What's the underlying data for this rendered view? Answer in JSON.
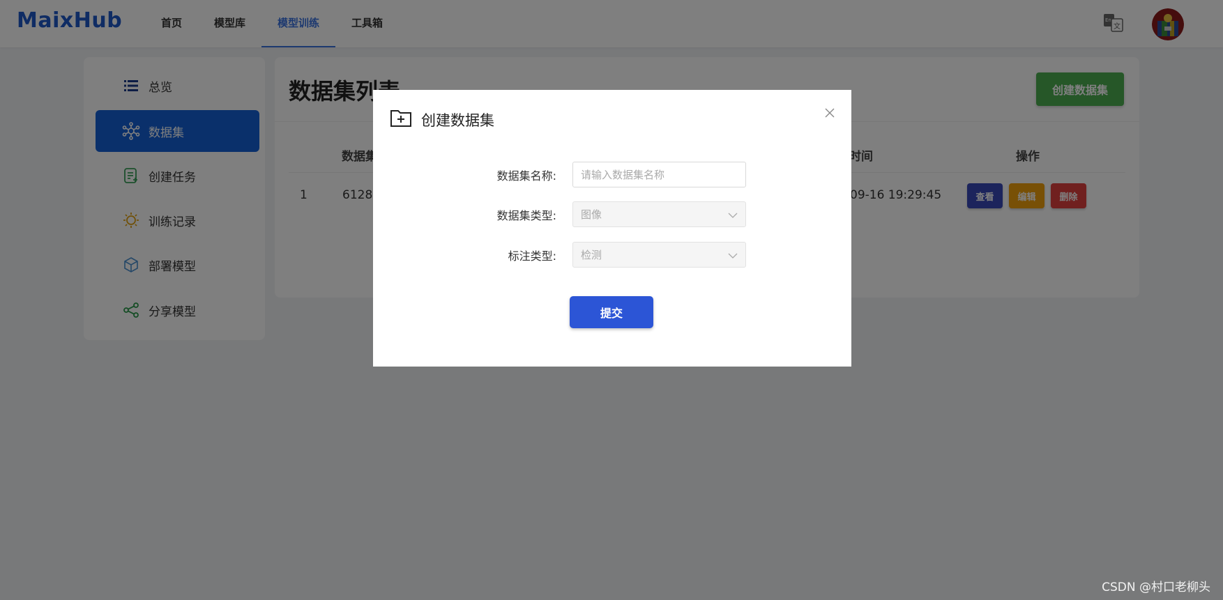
{
  "header": {
    "logo": "MaixHub",
    "nav": [
      "首页",
      "模型库",
      "模型训练",
      "工具箱"
    ],
    "active_nav": "模型训练"
  },
  "sidebar": {
    "items": [
      {
        "label": "总览",
        "icon": "list-icon"
      },
      {
        "label": "数据集",
        "icon": "dataset-icon",
        "active": true
      },
      {
        "label": "创建任务",
        "icon": "create-task-icon"
      },
      {
        "label": "训练记录",
        "icon": "training-record-icon"
      },
      {
        "label": "部署模型",
        "icon": "cube-icon"
      },
      {
        "label": "分享模型",
        "icon": "share-icon"
      }
    ]
  },
  "main": {
    "title": "数据集列表",
    "create_button": "创建数据集",
    "columns": {
      "name_partial": "数据集",
      "time_partial": "时间",
      "action": "操作"
    },
    "rows": [
      {
        "index": "1",
        "name_partial": "6128",
        "time_partial": "09-16 19:29:45"
      }
    ],
    "actions": {
      "view": "查看",
      "edit": "编辑",
      "delete": "删除"
    }
  },
  "modal": {
    "title": "创建数据集",
    "fields": {
      "name_label": "数据集名称:",
      "name_placeholder": "请输入数据集名称",
      "type_label": "数据集类型:",
      "type_value": "图像",
      "annotation_label": "标注类型:",
      "annotation_value": "检测"
    },
    "submit": "提交"
  },
  "watermark": "CSDN @村口老柳头",
  "colors": {
    "brand": "#1f58c9",
    "active_sidebar": "#1560d6",
    "create_button": "#4caf50",
    "view_button": "#3848b8",
    "edit_button": "#f0a00c",
    "delete_button": "#e0413e",
    "submit_button": "#2c55d6"
  }
}
